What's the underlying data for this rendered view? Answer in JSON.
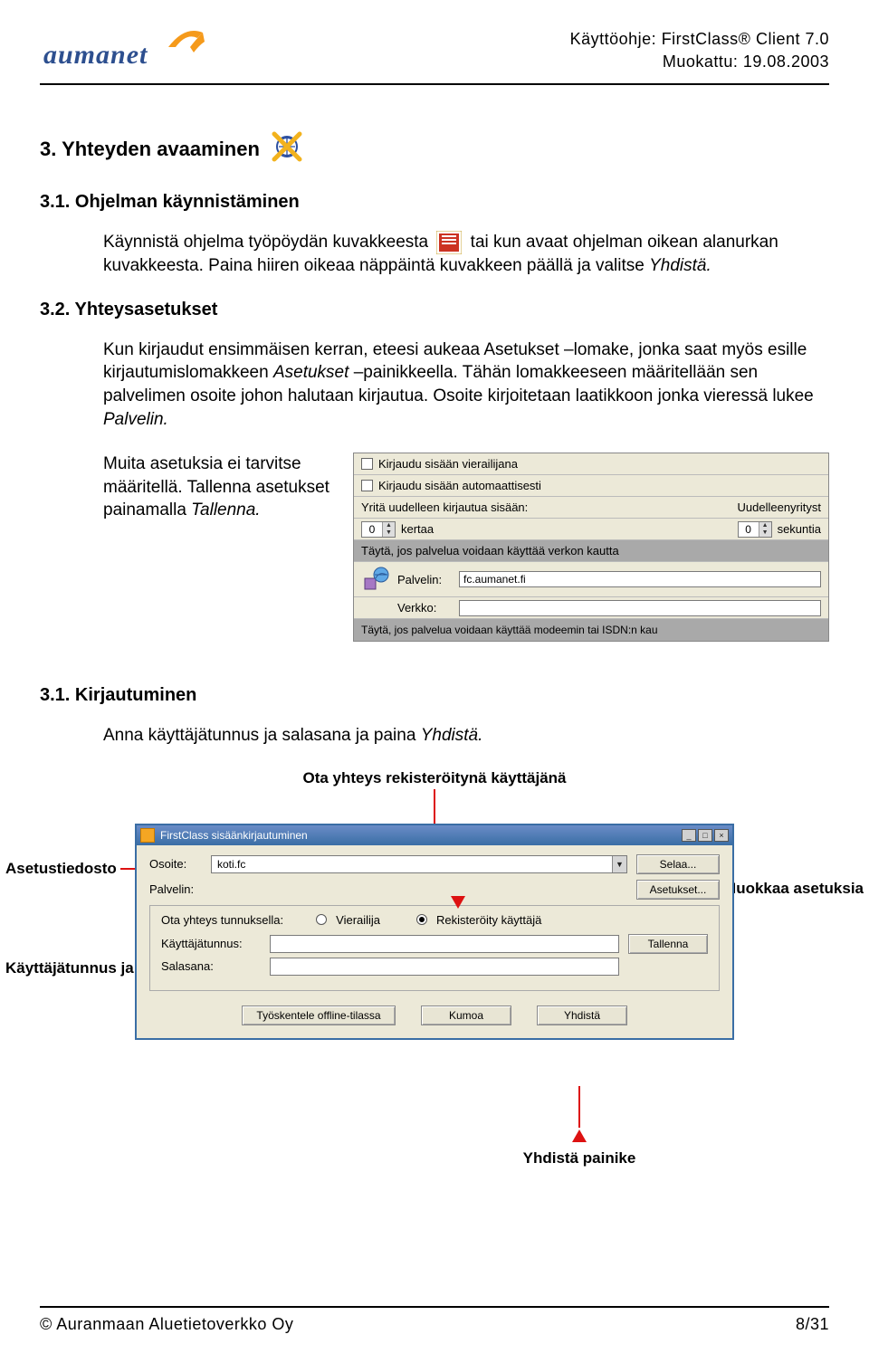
{
  "header": {
    "logo_text": "aumanet",
    "doc_title": "Käyttöohje: FirstClass® Client 7.0",
    "modified": "Muokattu: 19.08.2003"
  },
  "s3": {
    "title": "3. Yhteyden avaaminen"
  },
  "s31": {
    "title": "3.1. Ohjelman käynnistäminen",
    "p1a": "Käynnistä ohjelma työpöydän kuvakkeesta",
    "p1b": "tai kun avaat ohjelman oikean alanurkan kuvakkeesta. Paina hiiren oikeaa näppäintä kuvakkeen päällä ja valitse ",
    "p1c": "Yhdistä."
  },
  "s32": {
    "title": "3.2. Yhteysasetukset",
    "p1": "Kun kirjaudut ensimmäisen kerran, eteesi aukeaa Asetukset –lomake, jonka saat myös esille kirjautumislomakkeen ",
    "p1b": "Asetukset ",
    "p1c": "–painikkeella. Tähän lomakkeeseen määritellään sen palvelimen osoite johon halutaan kirjautua. Osoite kirjoitetaan laatikkoon jonka vieressä lukee ",
    "p1d": "Palvelin.",
    "p2": "Muita asetuksia ei tarvitse määritellä. Tallenna asetukset painamalla ",
    "p2b": "Tallenna."
  },
  "settings_panel": {
    "chk1": "Kirjaudu sisään vierailijana",
    "chk2": "Kirjaudu sisään automaattisesti",
    "retry_label": "Yritä uudelleen kirjautua sisään:",
    "retry_times": "0",
    "retry_unit": "kertaa",
    "retry_sec": "0",
    "retry_sec_unit": "sekuntia",
    "retry_header": "Uudelleenyrityst",
    "net_hint": "Täytä, jos palvelua voidaan käyttää verkon kautta",
    "server_label": "Palvelin:",
    "server_value": "fc.aumanet.fi",
    "net_label": "Verkko:",
    "isdn_hint": "Täytä, jos palvelua voidaan käyttää modeemin tai ISDN:n kau"
  },
  "s31b": {
    "title": "3.1. Kirjautuminen",
    "p1": "Anna käyttäjätunnus  ja salasana ja paina ",
    "p1b": "Yhdistä."
  },
  "callouts": {
    "registered": "Ota yhteys rekisteröitynä käyttäjänä",
    "settings_file": "Asetustiedosto",
    "edit_settings": "Muokkaa asetuksia",
    "user_pass": "Käyttäjätunnus ja salasana",
    "connect_btn": "Yhdistä painike"
  },
  "login": {
    "title": "FirstClass sisäänkirjautuminen",
    "address_label": "Osoite:",
    "address_value": "koti.fc",
    "server_label": "Palvelin:",
    "browse": "Selaa...",
    "settings": "Asetukset...",
    "connect_as": "Ota yhteys tunnuksella:",
    "guest": "Vierailija",
    "registered": "Rekisteröity käyttäjä",
    "user_label": "Käyttäjätunnus:",
    "pass_label": "Salasana:",
    "save": "Tallenna",
    "offline": "Työskentele offline-tilassa",
    "cancel": "Kumoa",
    "connect": "Yhdistä"
  },
  "footer": {
    "company": "© Auranmaan Aluetietoverkko Oy",
    "page": "8/31"
  }
}
